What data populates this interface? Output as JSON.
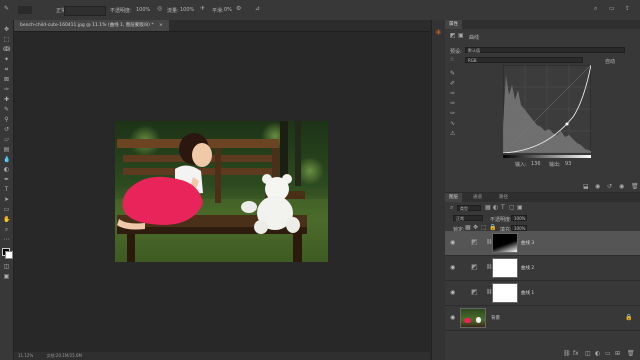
{
  "options_bar": {
    "items": [
      {
        "text": "30%"
      },
      {
        "text": "正常"
      },
      {
        "text": "不透明度:"
      },
      {
        "text": "100%"
      },
      {
        "text": "流量:"
      },
      {
        "text": "100%"
      },
      {
        "text": "平滑:"
      },
      {
        "text": "0%"
      }
    ]
  },
  "document_tab": {
    "label": "bench-child-cute-160411.jpg @ 11.1% (曲线 1, 图层蒙版/8) *",
    "close": "×"
  },
  "status_bar": {
    "zoom": "11.12%",
    "doc_info": "文档:20.1M/25.6M"
  },
  "properties_panel": {
    "tab_label": "属性",
    "header_label": "曲线",
    "preset_label": "预设:",
    "preset_value": "默认值",
    "channel_value": "RGB",
    "auto_button": "自动",
    "input_label": "输入:",
    "input_value": "136",
    "output_label": "输出:",
    "output_value": "93"
  },
  "layers_panel": {
    "tabs": [
      "图层",
      "通道",
      "路径"
    ],
    "filter_kind": "类型",
    "blend_mode": "正常",
    "opacity_label": "不透明度:",
    "opacity_value": "100%",
    "lock_label": "锁定:",
    "fill_label": "填充:",
    "fill_value": "100%",
    "layers": [
      {
        "name": "曲线 3",
        "selected": true
      },
      {
        "name": "曲线 2",
        "selected": false
      },
      {
        "name": "曲线 1",
        "selected": false
      },
      {
        "name": "背景",
        "selected": false
      }
    ]
  },
  "colors": {
    "tutu": "#e8245a",
    "accent": "#e6782a"
  }
}
